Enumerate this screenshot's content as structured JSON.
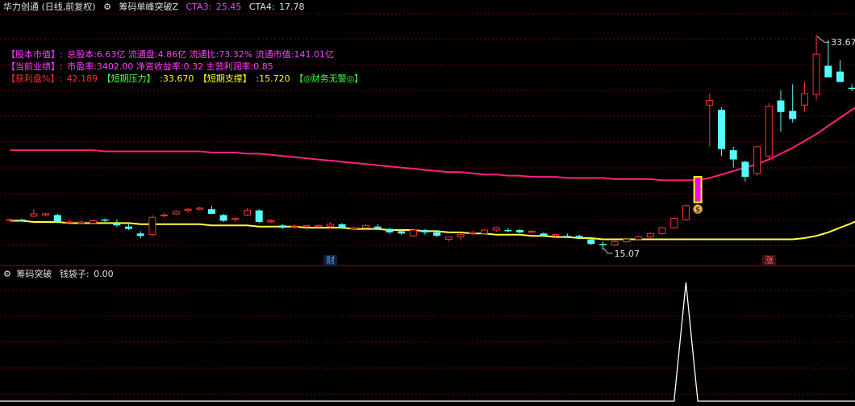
{
  "header": {
    "stock": "华力创通 (日线,前复权)",
    "indicator": "筹码单峰突破Z",
    "cta3_label": "CTA3:",
    "cta3_value": "25.45",
    "cta4_label": "CTA4:",
    "cta4_value": "17.78"
  },
  "info": {
    "line1_label": "【股本市值】:",
    "line1_text": "总股本:6.63亿 流通盘:4.86亿 流通比:73.32% 流通市值:141.01亿",
    "line2_label": "【当前业绩】:",
    "line2_text": "市盈率:3402.00 净资收益率:0.32 主营利润率:0.85",
    "line3_label": "【获利盘%】:",
    "line3_value": "42.189",
    "line3_pressure_label": "【短期压力】",
    "line3_pressure_value": ":33.670",
    "line3_support_label": "【短期支撑】",
    "line3_support_value": ":15.720",
    "line3_warning": "【◎财务无警◎】"
  },
  "markers": {
    "cai": "财",
    "zhang": "涨",
    "money": "$",
    "high_label": "33.67",
    "low_label": "15.07"
  },
  "sub_header": {
    "indicator": "筹码突破",
    "series_label": "钱袋子:",
    "series_value": "0.00"
  },
  "colors": {
    "up": "#ff3232",
    "down": "#54ffff",
    "pink_line": "#ff2080",
    "yellow_line": "#ffff40",
    "grid": "#800000",
    "signal_fill": "#ff00ff",
    "signal_border": "#ffff00"
  },
  "chart_data": {
    "type": "candlestick",
    "y_range": [
      13.8,
      35.5
    ],
    "candles": [
      [
        17.7,
        17.8,
        17.6,
        17.7
      ],
      [
        17.7,
        17.8,
        17.6,
        17.6
      ],
      [
        18.0,
        18.6,
        17.9,
        18.2
      ],
      [
        18.1,
        18.3,
        18.0,
        18.2
      ],
      [
        18.1,
        18.2,
        17.8,
        17.5
      ],
      [
        17.5,
        17.7,
        17.4,
        17.5
      ],
      [
        17.4,
        17.6,
        17.3,
        17.5
      ],
      [
        17.4,
        17.7,
        17.3,
        17.6
      ],
      [
        17.7,
        17.8,
        17.5,
        17.6
      ],
      [
        17.4,
        17.7,
        17.1,
        17.2
      ],
      [
        17.1,
        17.3,
        16.8,
        16.9
      ],
      [
        16.5,
        16.7,
        16.1,
        16.3
      ],
      [
        16.4,
        18.1,
        16.3,
        17.9
      ],
      [
        18.1,
        18.3,
        17.9,
        18.1
      ],
      [
        18.2,
        18.5,
        18.1,
        18.4
      ],
      [
        18.5,
        18.7,
        18.3,
        18.6
      ],
      [
        18.6,
        18.8,
        18.5,
        18.7
      ],
      [
        18.6,
        18.9,
        18.4,
        18.2
      ],
      [
        18.1,
        18.2,
        17.5,
        17.6
      ],
      [
        17.7,
        17.9,
        17.5,
        17.8
      ],
      [
        18.1,
        18.7,
        18.0,
        18.5
      ],
      [
        18.5,
        18.6,
        17.4,
        17.5
      ],
      [
        17.5,
        17.7,
        17.4,
        17.6
      ],
      [
        17.2,
        17.3,
        16.9,
        17.0
      ],
      [
        17.1,
        17.3,
        16.9,
        17.1
      ],
      [
        17.1,
        17.2,
        16.8,
        17.2
      ],
      [
        17.1,
        17.3,
        17.0,
        17.2
      ],
      [
        17.1,
        17.5,
        16.9,
        17.3
      ],
      [
        17.3,
        17.4,
        16.9,
        17.0
      ],
      [
        16.9,
        17.1,
        16.8,
        17.0
      ],
      [
        17.0,
        17.3,
        16.9,
        17.2
      ],
      [
        17.1,
        17.3,
        16.9,
        16.9
      ],
      [
        16.9,
        17.0,
        16.5,
        16.6
      ],
      [
        16.7,
        16.8,
        16.4,
        16.5
      ],
      [
        16.3,
        16.9,
        16.2,
        16.8
      ],
      [
        16.8,
        16.9,
        16.4,
        16.6
      ],
      [
        16.6,
        16.8,
        16.2,
        16.3
      ],
      [
        16.0,
        16.1,
        15.8,
        16.2
      ],
      [
        16.2,
        16.5,
        15.9,
        16.4
      ],
      [
        16.5,
        16.7,
        16.4,
        16.6
      ],
      [
        16.5,
        16.9,
        16.4,
        16.8
      ],
      [
        16.8,
        17.1,
        16.6,
        17.0
      ],
      [
        16.8,
        17.0,
        16.6,
        16.7
      ],
      [
        16.8,
        16.9,
        16.5,
        16.6
      ],
      [
        16.6,
        16.8,
        16.5,
        16.7
      ],
      [
        16.5,
        16.6,
        16.2,
        16.3
      ],
      [
        16.3,
        16.5,
        16.1,
        16.4
      ],
      [
        16.3,
        16.5,
        16.1,
        16.2
      ],
      [
        16.3,
        16.4,
        16.1,
        16.1
      ],
      [
        16.0,
        16.2,
        15.5,
        15.6
      ],
      [
        15.6,
        15.8,
        15.07,
        15.5
      ],
      [
        15.5,
        15.9,
        15.4,
        15.8
      ],
      [
        15.8,
        16.1,
        15.7,
        16.0
      ],
      [
        16.0,
        16.3,
        15.9,
        16.2
      ],
      [
        16.2,
        16.6,
        16.1,
        16.5
      ],
      [
        16.5,
        17.1,
        16.4,
        17.0
      ],
      [
        17.0,
        17.9,
        16.9,
        17.8
      ],
      [
        17.7,
        19.0,
        17.6,
        18.9
      ],
      [
        19.2,
        21.4,
        19.1,
        21.4
      ],
      [
        27.6,
        28.6,
        24.0,
        28.0
      ],
      [
        27.2,
        27.4,
        23.2,
        23.8
      ],
      [
        23.7,
        24.0,
        22.2,
        22.9
      ],
      [
        22.7,
        22.8,
        21.0,
        21.4
      ],
      [
        21.7,
        24.0,
        21.5,
        24.0
      ],
      [
        23.2,
        27.8,
        22.8,
        27.5
      ],
      [
        28.0,
        28.9,
        25.3,
        27.0
      ],
      [
        27.1,
        29.4,
        26.1,
        26.4
      ],
      [
        27.6,
        29.6,
        27.0,
        28.6
      ],
      [
        28.5,
        33.67,
        28.0,
        32.0
      ],
      [
        31.0,
        33.2,
        30.4,
        30.0
      ],
      [
        30.5,
        31.5,
        29.6,
        29.6
      ],
      [
        29.1,
        29.4,
        28.8,
        29.0
      ],
      [
        29.2,
        30.8,
        29.1,
        29.8
      ]
    ],
    "pink_ma": [
      23.7,
      23.7,
      23.7,
      23.7,
      23.7,
      23.7,
      23.7,
      23.7,
      23.6,
      23.6,
      23.6,
      23.6,
      23.6,
      23.6,
      23.6,
      23.6,
      23.6,
      23.5,
      23.5,
      23.5,
      23.4,
      23.4,
      23.3,
      23.2,
      23.1,
      23.0,
      22.9,
      22.8,
      22.7,
      22.6,
      22.5,
      22.4,
      22.3,
      22.2,
      22.1,
      22.0,
      21.9,
      21.8,
      21.8,
      21.7,
      21.6,
      21.6,
      21.5,
      21.5,
      21.4,
      21.4,
      21.4,
      21.3,
      21.3,
      21.3,
      21.3,
      21.2,
      21.2,
      21.2,
      21.2,
      21.1,
      21.1,
      21.1,
      21.1,
      21.3,
      21.6,
      21.9,
      22.2,
      22.5,
      22.9,
      23.4,
      23.9,
      24.5,
      25.1,
      25.8,
      26.5,
      27.2,
      27.9
    ],
    "yellow_ma": [
      17.6,
      17.6,
      17.5,
      17.5,
      17.5,
      17.4,
      17.4,
      17.4,
      17.4,
      17.4,
      17.4,
      17.3,
      17.3,
      17.3,
      17.3,
      17.3,
      17.3,
      17.2,
      17.2,
      17.2,
      17.2,
      17.1,
      17.1,
      17.1,
      17.1,
      17.0,
      17.0,
      17.0,
      17.0,
      16.9,
      16.9,
      16.9,
      16.8,
      16.8,
      16.8,
      16.7,
      16.7,
      16.6,
      16.6,
      16.5,
      16.5,
      16.4,
      16.4,
      16.4,
      16.3,
      16.3,
      16.2,
      16.2,
      16.1,
      16.1,
      16.0,
      16.0,
      16.0,
      16.0,
      16.0,
      16.0,
      16.0,
      16.0,
      16.0,
      16.0,
      16.0,
      16.0,
      16.0,
      16.0,
      16.0,
      16.0,
      16.0,
      16.1,
      16.3,
      16.6,
      17.0,
      17.4,
      17.9
    ],
    "signal_index": 58,
    "indicator_values": [
      0,
      0,
      0,
      0,
      0,
      0,
      0,
      0,
      0,
      0,
      0,
      0,
      0,
      0,
      0,
      0,
      0,
      0,
      0,
      0,
      0,
      0,
      0,
      0,
      0,
      0,
      0,
      0,
      0,
      0,
      0,
      0,
      0,
      0,
      0,
      0,
      0,
      0,
      0,
      0,
      0,
      0,
      0,
      0,
      0,
      0,
      0,
      0,
      0,
      0,
      0,
      0,
      0,
      0,
      0,
      0,
      0,
      1,
      0,
      0,
      0,
      0,
      0,
      0,
      0,
      0,
      0,
      0,
      0,
      0,
      0,
      0,
      0
    ],
    "high_index": 68,
    "low_index": 50,
    "cai_index": 27,
    "zhang_index": 64
  }
}
